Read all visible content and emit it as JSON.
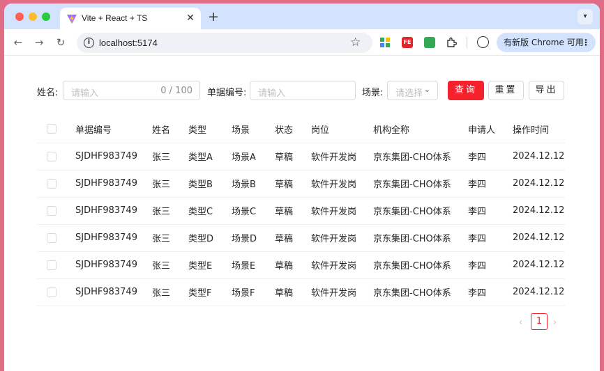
{
  "browser": {
    "tab_title": "Vite + React + TS",
    "tab_close": "✕",
    "new_tab": "+",
    "url": "localhost:5174",
    "update_label": "有新版 Chrome 可用",
    "update_menu": "⋮",
    "ext_fe_label": "FE",
    "icons": [
      "back-arrow-icon",
      "forward-arrow-icon",
      "reload-icon",
      "site-info-icon",
      "bookmark-star-icon",
      "extensions-icon",
      "profile-icon"
    ]
  },
  "filters": {
    "name_label": "姓名:",
    "name_placeholder": "请输入",
    "name_counter": "0 / 100",
    "doc_no_label": "单据编号:",
    "doc_no_placeholder": "请输入",
    "scene_label": "场景:",
    "scene_placeholder": "请选择",
    "query_button": "查询",
    "reset_button": "重置",
    "export_button": "导出"
  },
  "table": {
    "columns": [
      "单据编号",
      "姓名",
      "类型",
      "场景",
      "状态",
      "岗位",
      "机构全称",
      "申请人",
      "操作时间"
    ],
    "rows": [
      [
        "SJDHF983749",
        "张三",
        "类型A",
        "场景A",
        "草稿",
        "软件开发岗",
        "京东集团-CHO体系",
        "李四",
        "2024.12.12"
      ],
      [
        "SJDHF983749",
        "张三",
        "类型B",
        "场景B",
        "草稿",
        "软件开发岗",
        "京东集团-CHO体系",
        "李四",
        "2024.12.12"
      ],
      [
        "SJDHF983749",
        "张三",
        "类型C",
        "场景C",
        "草稿",
        "软件开发岗",
        "京东集团-CHO体系",
        "李四",
        "2024.12.12"
      ],
      [
        "SJDHF983749",
        "张三",
        "类型D",
        "场景D",
        "草稿",
        "软件开发岗",
        "京东集团-CHO体系",
        "李四",
        "2024.12.12"
      ],
      [
        "SJDHF983749",
        "张三",
        "类型E",
        "场景E",
        "草稿",
        "软件开发岗",
        "京东集团-CHO体系",
        "李四",
        "2024.12.12"
      ],
      [
        "SJDHF983749",
        "张三",
        "类型F",
        "场景F",
        "草稿",
        "软件开发岗",
        "京东集团-CHO体系",
        "李四",
        "2024.12.12"
      ]
    ]
  },
  "pagination": {
    "prev": "‹",
    "current_page": "1",
    "next": "›"
  },
  "colors": {
    "primary": "#f5222d",
    "tab_strip": "#d3e3fd",
    "desktop": "#e06c86"
  }
}
